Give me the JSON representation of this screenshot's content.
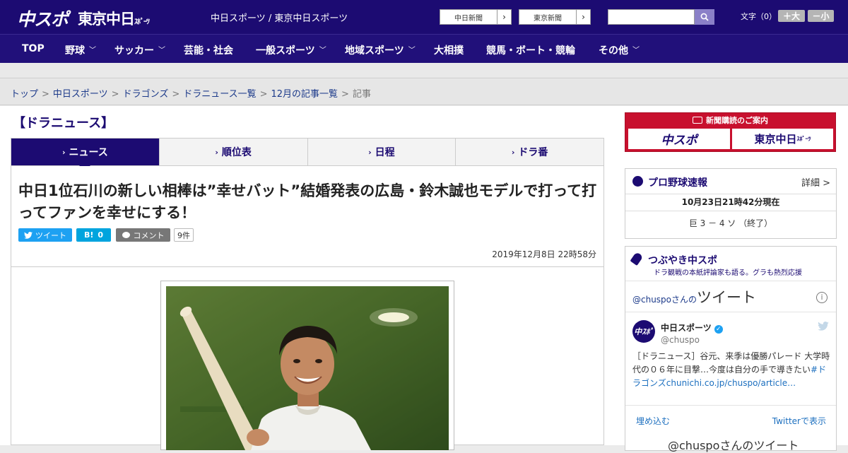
{
  "header": {
    "logo_primary": "中スポ",
    "logo_secondary": "東京中日",
    "logo_secondary_small": "ｽﾎﾟｰﾂ",
    "site_links": "中日スポーツ / 東京中日スポーツ",
    "site_btn_1": "中日新聞",
    "site_btn_2": "東京新聞",
    "search_placeholder": "",
    "font_label": "文字（0）",
    "font_larger": "＋大",
    "font_smaller": "－小"
  },
  "nav": {
    "items": [
      {
        "label": "TOP",
        "has_menu": false
      },
      {
        "label": "野球",
        "has_menu": true
      },
      {
        "label": "サッカー",
        "has_menu": true
      },
      {
        "label": "芸能・社会",
        "has_menu": false
      },
      {
        "label": "一般スポーツ",
        "has_menu": true
      },
      {
        "label": "地域スポーツ",
        "has_menu": true
      },
      {
        "label": "大相撲",
        "has_menu": false
      },
      {
        "label": "競馬・ボート・競輪",
        "has_menu": false
      },
      {
        "label": "その他",
        "has_menu": true
      }
    ]
  },
  "breadcrumb": {
    "items": [
      "トップ",
      "中日スポーツ",
      "ドラゴンズ",
      "ドラニュース一覧",
      "12月の記事一覧"
    ],
    "current": "記事"
  },
  "section": {
    "title": "【ドラニュース】"
  },
  "tabs": [
    {
      "label": "ニュース",
      "active": true
    },
    {
      "label": "順位表",
      "active": false
    },
    {
      "label": "日程",
      "active": false
    },
    {
      "label": "ドラ番",
      "active": false
    }
  ],
  "article": {
    "headline": "中日1位石川の新しい相棒は”幸せバット”結婚発表の広島・鈴木誠也モデルで打って打ってファンを幸せにする！",
    "tweet_label": "ツイート",
    "hatena_label": "B!",
    "hatena_count": "0",
    "comment_label": "コメント",
    "comment_count": "9件",
    "date": "2019年12月8日 22時58分"
  },
  "sidebar": {
    "ad_title": "新聞購読のご案内",
    "ad_logo_1": "中スポ",
    "ad_logo_2": "東京中日",
    "ad_logo_2_small": "ｽﾎﾟｰﾂ",
    "scores": {
      "title": "プロ野球速報",
      "detail": "詳細 >",
      "as_of": "10月23日21時42分現在",
      "result": "巨 3 － 4 ソ （終了）"
    },
    "twitter": {
      "title": "つぶやき中スポ",
      "subtitle": "ドラ観戦の本紙評論家も語る。グラも熱烈応援",
      "handle_prefix": "@chuspoさんの",
      "handle_big": "ツイート",
      "account_name": "中日スポーツ",
      "account_user": "@chuspo",
      "avatar_text": "中ｽﾎﾟ",
      "tweet_text": "［ドラニュース］谷元、来季は優勝パレード 大学時代の０６年に目撃…今度は自分の手で導きたい",
      "tweet_link": "#ドラゴンズchunichi.co.jp/chuspo/article…",
      "embed_label": "埋め込む",
      "view_on_twitter": "Twitterで表示",
      "more_tweets": "@chuspoさんのツイート"
    }
  },
  "colors": {
    "brand_navy": "#1c0b72",
    "ad_red": "#c8102e",
    "twitter_blue": "#1da1f2",
    "hatena_blue": "#00a4de",
    "comment_gray": "#777777"
  }
}
